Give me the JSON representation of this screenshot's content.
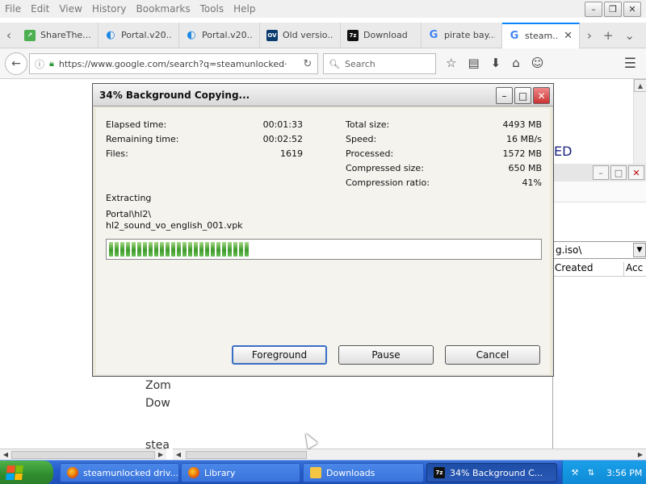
{
  "browser": {
    "menu": [
      "File",
      "Edit",
      "View",
      "History",
      "Bookmarks",
      "Tools",
      "Help"
    ],
    "tabs": [
      {
        "label": "ShareThe...",
        "icon": "share-icon"
      },
      {
        "label": "Portal.v20...",
        "icon": "portal-icon"
      },
      {
        "label": "Portal.v20...",
        "icon": "portal-icon"
      },
      {
        "label": "Old versio...",
        "icon": "ov-icon"
      },
      {
        "label": "Download",
        "icon": "sevenzip-icon"
      },
      {
        "label": "pirate bay...",
        "icon": "google-icon"
      },
      {
        "label": "steam...",
        "icon": "google-icon",
        "active": true
      }
    ],
    "url": "https://www.google.com/search?q=steamunlocked·",
    "search_placeholder": "Search"
  },
  "page": {
    "fragment_top": "...",
    "fragment_ed": "ED",
    "left_words": [
      "Zom",
      "Dow",
      "stea"
    ]
  },
  "explorer": {
    "address": "g.iso\\",
    "col_created": "Created",
    "col_acc": "Acc"
  },
  "dialog": {
    "title": "34% Background Copying...",
    "elapsed_label": "Elapsed time:",
    "elapsed_value": "00:01:33",
    "remaining_label": "Remaining time:",
    "remaining_value": "00:02:52",
    "files_label": "Files:",
    "files_value": "1619",
    "total_label": "Total size:",
    "total_value": "4493 MB",
    "speed_label": "Speed:",
    "speed_value": "16 MB/s",
    "processed_label": "Processed:",
    "processed_value": "1572 MB",
    "compressed_label": "Compressed size:",
    "compressed_value": "650 MB",
    "ratio_label": "Compression ratio:",
    "ratio_value": "41%",
    "operation": "Extracting",
    "path_line1": "Portal\\hl2\\",
    "path_line2": "hl2_sound_vo_english_001.vpk",
    "progress_percent": 34,
    "btn_foreground": "Foreground",
    "btn_pause": "Pause",
    "btn_cancel": "Cancel"
  },
  "taskbar": {
    "start_label": "",
    "tasks": [
      {
        "label": "steamunlocked driv...",
        "icon": "firefox-icon"
      },
      {
        "label": "Library",
        "icon": "firefox-icon"
      },
      {
        "label": "Downloads",
        "icon": "folder-icon"
      },
      {
        "label": "34% Background C...",
        "icon": "sevenzip-icon",
        "active": true
      }
    ],
    "clock": "3:56 PM"
  },
  "colors": {
    "progress_green": "#3c9a2a",
    "taskbar_blue": "#235cd0",
    "start_green": "#2f8b2d",
    "tab_accent": "#0a84ff"
  }
}
